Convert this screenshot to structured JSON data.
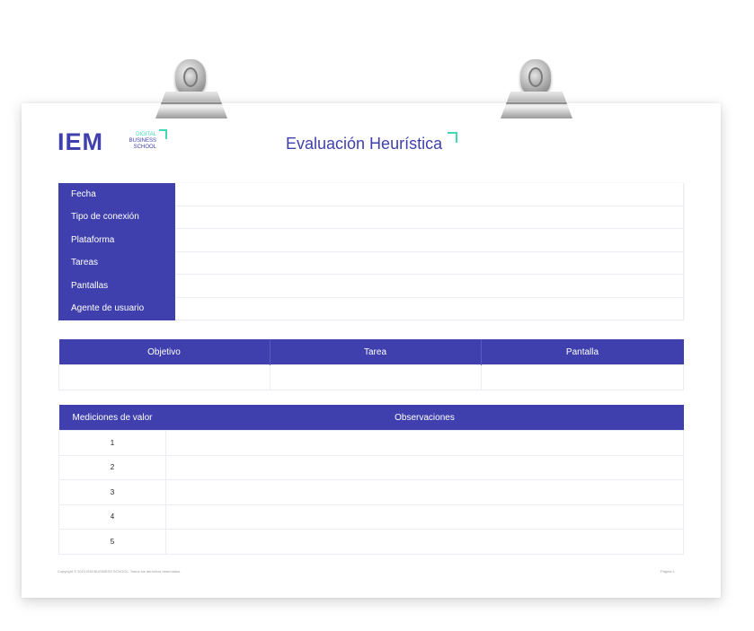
{
  "logo": {
    "main": "IEM",
    "digital": "DIGITAL",
    "business": "BUSINESS",
    "school": "SCHOOL"
  },
  "title": "Evaluación Heurística",
  "info_rows": [
    {
      "label": "Fecha",
      "value": ""
    },
    {
      "label": "Tipo de conexión",
      "value": ""
    },
    {
      "label": "Plataforma",
      "value": ""
    },
    {
      "label": "Tareas",
      "value": ""
    },
    {
      "label": "Pantallas",
      "value": ""
    },
    {
      "label": "Agente de usuario",
      "value": ""
    }
  ],
  "objective_table": {
    "headers": [
      "Objetivo",
      "Tarea",
      "Pantalla"
    ],
    "row": [
      "",
      "",
      ""
    ]
  },
  "measurements_table": {
    "headers": [
      "Mediciones de valor",
      "Observaciones"
    ],
    "rows": [
      {
        "num": "1",
        "obs": ""
      },
      {
        "num": "2",
        "obs": ""
      },
      {
        "num": "3",
        "obs": ""
      },
      {
        "num": "4",
        "obs": ""
      },
      {
        "num": "5",
        "obs": ""
      }
    ]
  },
  "footer": {
    "copyright": "Copyright © 2021 IEM BUSINESS SCHOOL. Todos los derechos reservados.",
    "page": "Página 1"
  },
  "colors": {
    "primary": "#3f40ad",
    "accent": "#3fd8b4"
  }
}
